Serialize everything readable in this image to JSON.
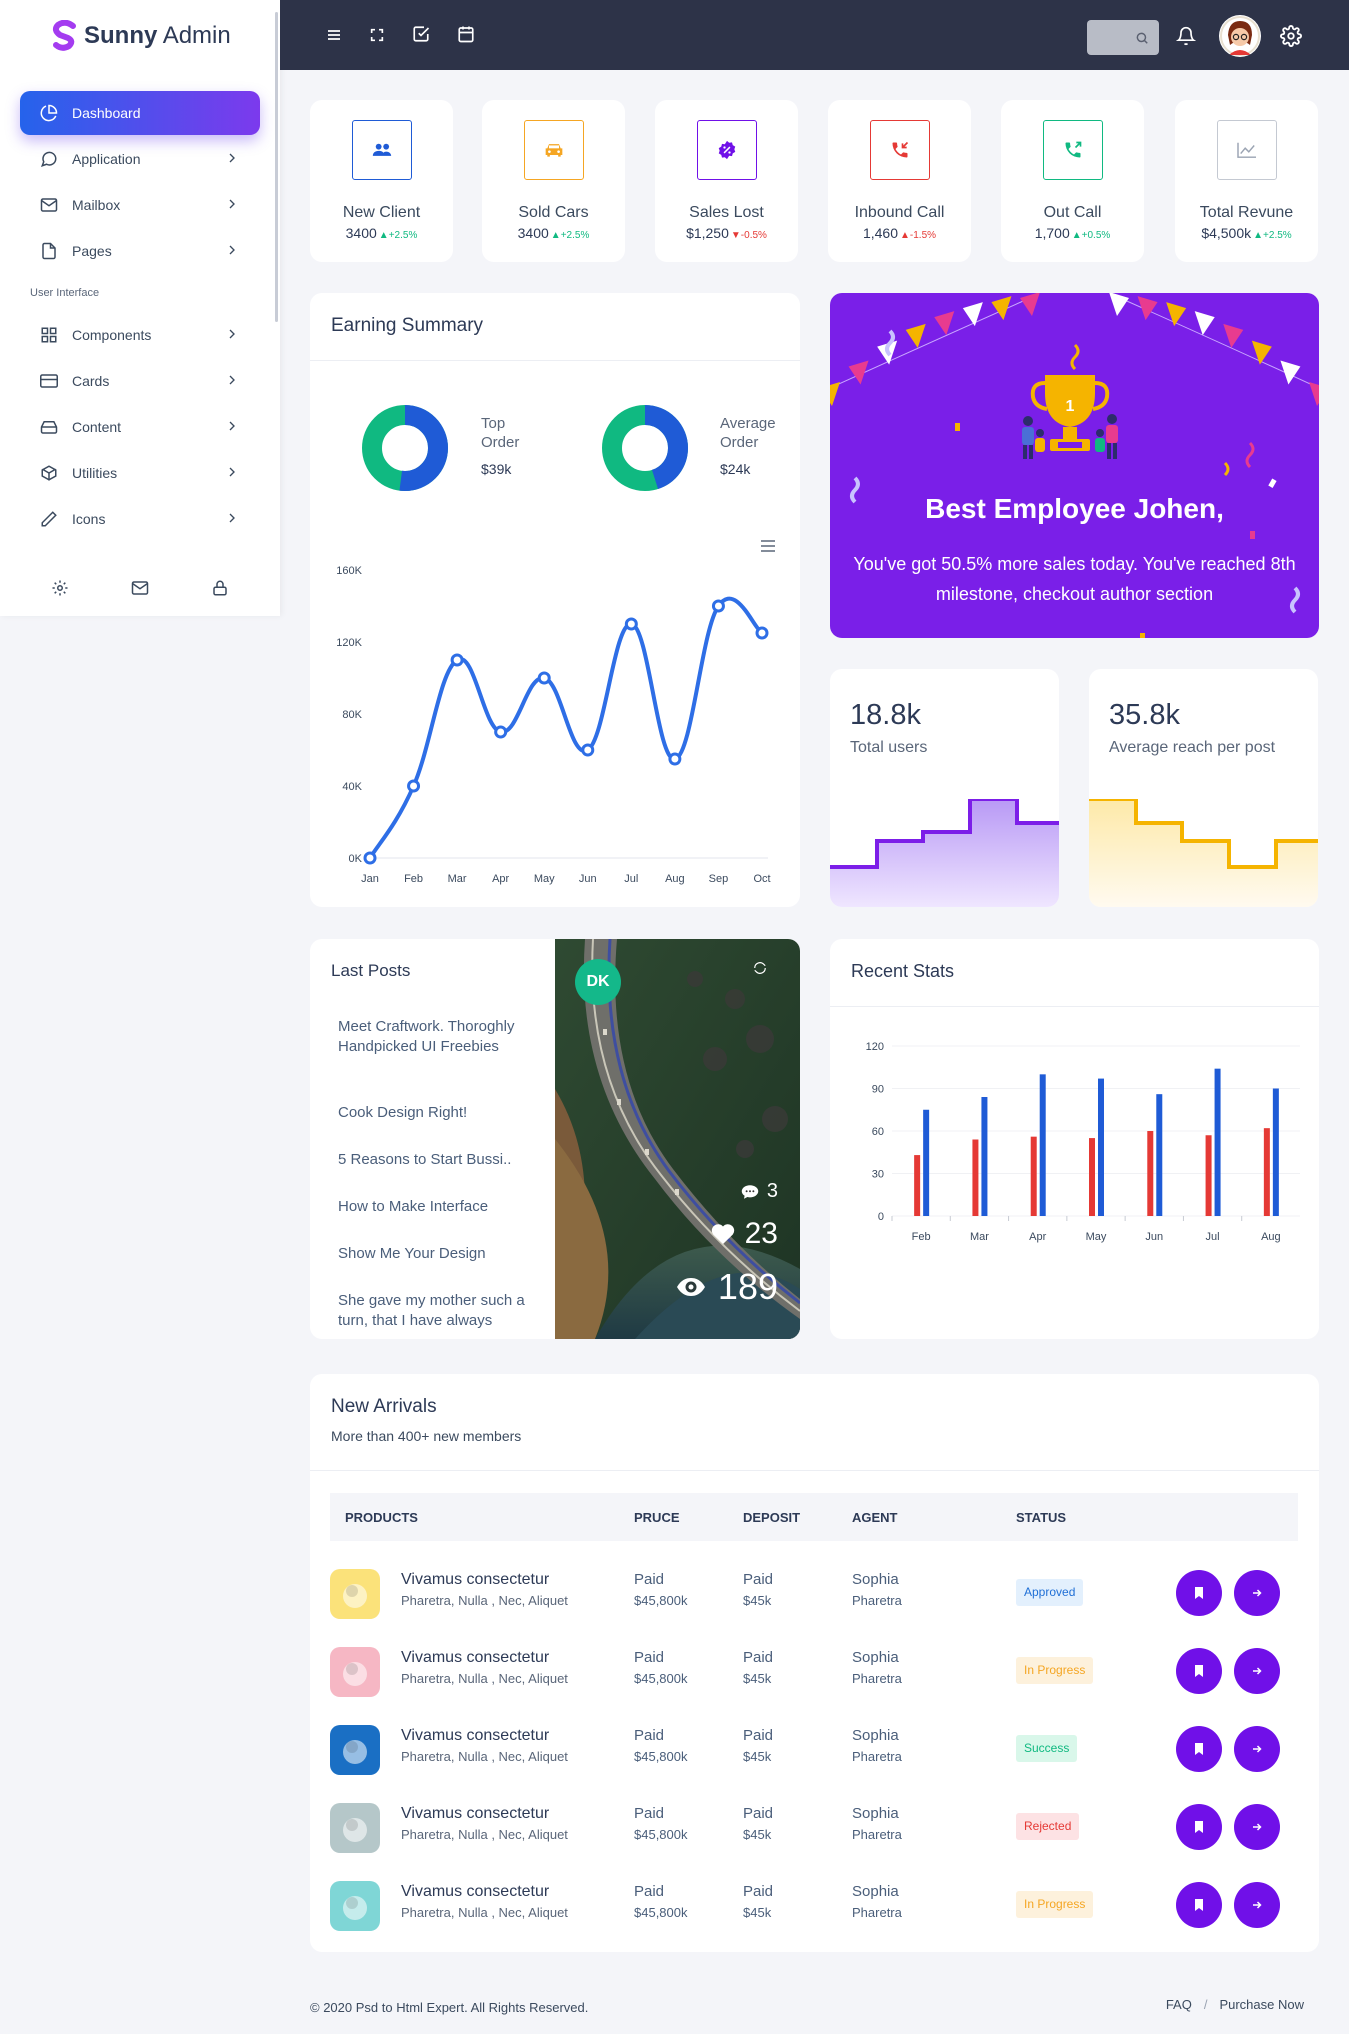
{
  "brand": {
    "name_bold": "Sunny",
    "name_light": "Admin"
  },
  "sidebar": {
    "items": [
      {
        "label": "Dashboard",
        "icon": "pie-chart-icon"
      },
      {
        "label": "Application",
        "icon": "chat-icon"
      },
      {
        "label": "Mailbox",
        "icon": "mail-icon"
      },
      {
        "label": "Pages",
        "icon": "file-icon"
      },
      {
        "label": "Components",
        "icon": "grid-icon"
      },
      {
        "label": "Cards",
        "icon": "credit-card-icon"
      },
      {
        "label": "Content",
        "icon": "hard-drive-icon"
      },
      {
        "label": "Utilities",
        "icon": "package-icon"
      },
      {
        "label": "Icons",
        "icon": "pen-icon"
      }
    ],
    "section_label": "User Interface",
    "footer_icons": [
      "settings-icon",
      "mail-icon",
      "lock-icon"
    ]
  },
  "topbar": {
    "icons": [
      "menu-icon",
      "fullscreen-icon",
      "check-square-icon",
      "calendar-icon",
      "search-icon",
      "bell-icon",
      "settings-icon"
    ]
  },
  "kpis": [
    {
      "label": "New Client",
      "value": "3400",
      "change": "+2.5%",
      "dir": "up",
      "color": "#1f5bd6"
    },
    {
      "label": "Sold Cars",
      "value": "3400",
      "change": "+2.5%",
      "dir": "up",
      "color": "#f5a623"
    },
    {
      "label": "Sales Lost",
      "value": "$1,250",
      "change": "-0.5%",
      "dir": "down",
      "color": "#7010e8"
    },
    {
      "label": "Inbound Call",
      "value": "1,460",
      "change": "-1.5%",
      "dir": "down",
      "color": "#e53935"
    },
    {
      "label": "Out Call",
      "value": "1,700",
      "change": "+0.5%",
      "dir": "up",
      "color": "#10b981"
    },
    {
      "label": "Total Revune",
      "value": "$4,500k",
      "change": "+2.5%",
      "dir": "up",
      "color": "#9aa3b2"
    }
  ],
  "earning": {
    "title": "Earning Summary",
    "donuts": [
      {
        "label1": "Top",
        "label2": "Order",
        "value": "$39k",
        "primary": "#1f5bd6",
        "secondary": "#10b981",
        "share": 0.52
      },
      {
        "label1": "Average",
        "label2": "Order",
        "value": "$24k",
        "primary": "#1f5bd6",
        "secondary": "#10b981",
        "share": 0.45
      }
    ]
  },
  "chart_data": [
    {
      "type": "line",
      "categories": [
        "Jan",
        "Feb",
        "Mar",
        "Apr",
        "May",
        "Jun",
        "Jul",
        "Aug",
        "Sep",
        "Oct"
      ],
      "series": [
        {
          "values": [
            0,
            40,
            110,
            70,
            100,
            60,
            130,
            55,
            140,
            125
          ],
          "color": "#2e6ee6"
        }
      ],
      "yticks": [
        "0K",
        "40K",
        "80K",
        "120K",
        "160K"
      ],
      "ylim": [
        0,
        160
      ]
    },
    {
      "type": "bar",
      "title": "Recent Stats",
      "categories": [
        "Feb",
        "Mar",
        "Apr",
        "May",
        "Jun",
        "Jul",
        "Aug"
      ],
      "series": [
        {
          "values": [
            43,
            54,
            56,
            55,
            60,
            57,
            62
          ],
          "color": "#e53935"
        },
        {
          "values": [
            75,
            84,
            100,
            97,
            86,
            104,
            90
          ],
          "color": "#1f5bd6"
        }
      ],
      "yticks": [
        "0",
        "30",
        "60",
        "90",
        "120"
      ],
      "ylim": [
        0,
        120
      ]
    }
  ],
  "banner": {
    "title": "Best Employee Johen,",
    "text": "You've got 50.5% more sales today. You've reached 8th milestone, checkout author section"
  },
  "stats": [
    {
      "value": "18.8k",
      "label": "Total users",
      "color": "#7c1ee8"
    },
    {
      "value": "35.8k",
      "label": "Average reach per post",
      "color": "#f5b400"
    }
  ],
  "posts": {
    "title": "Last Posts",
    "items": [
      "Meet Craftwork. Thoroghly Handpicked UI Freebies",
      "Cook Design Right!",
      "5 Reasons to Start Bussi..",
      "How to Make Interface",
      "Show Me Your Design",
      "She gave my mother such a turn, that I have always"
    ],
    "avatar_initials": "DK",
    "comments": "3",
    "likes": "23",
    "views": "189"
  },
  "arrivals": {
    "title": "New Arrivals",
    "subtitle": "More than 400+ new members",
    "headers": [
      "PRODUCTS",
      "PRUCE",
      "DEPOSIT",
      "AGENT",
      "STATUS"
    ],
    "rows": [
      {
        "name": "Vivamus consectetur",
        "sub": "Pharetra, Nulla , Nec, Aliquet",
        "price1": "Paid",
        "price2": "$45,800k",
        "dep1": "Paid",
        "dep2": "$45k",
        "agent1": "Sophia",
        "agent2": "Pharetra",
        "status": "Approved",
        "bg": "#e3f0fd",
        "fg": "#1f6fd6",
        "thumb": "#fbe27a"
      },
      {
        "name": "Vivamus consectetur",
        "sub": "Pharetra, Nulla , Nec, Aliquet",
        "price1": "Paid",
        "price2": "$45,800k",
        "dep1": "Paid",
        "dep2": "$45k",
        "agent1": "Sophia",
        "agent2": "Pharetra",
        "status": "In Progress",
        "bg": "#fdf1dc",
        "fg": "#f5a623",
        "thumb": "#f6b7c4"
      },
      {
        "name": "Vivamus consectetur",
        "sub": "Pharetra, Nulla , Nec, Aliquet",
        "price1": "Paid",
        "price2": "$45,800k",
        "dep1": "Paid",
        "dep2": "$45k",
        "agent1": "Sophia",
        "agent2": "Pharetra",
        "status": "Success",
        "bg": "#d9f7ea",
        "fg": "#10b981",
        "thumb": "#1a6fc4"
      },
      {
        "name": "Vivamus consectetur",
        "sub": "Pharetra, Nulla , Nec, Aliquet",
        "price1": "Paid",
        "price2": "$45,800k",
        "dep1": "Paid",
        "dep2": "$45k",
        "agent1": "Sophia",
        "agent2": "Pharetra",
        "status": "Rejected",
        "bg": "#fde2e4",
        "fg": "#e53935",
        "thumb": "#b5c7c9"
      },
      {
        "name": "Vivamus consectetur",
        "sub": "Pharetra, Nulla , Nec, Aliquet",
        "price1": "Paid",
        "price2": "$45,800k",
        "dep1": "Paid",
        "dep2": "$45k",
        "agent1": "Sophia",
        "agent2": "Pharetra",
        "status": "In Progress",
        "bg": "#fdf1dc",
        "fg": "#f5a623",
        "thumb": "#7fd6d6"
      }
    ]
  },
  "footer": {
    "copyright": "© 2020 Psd to Html Expert. All Rights Reserved.",
    "links": [
      "FAQ",
      "Purchase Now"
    ],
    "separator": "/"
  }
}
